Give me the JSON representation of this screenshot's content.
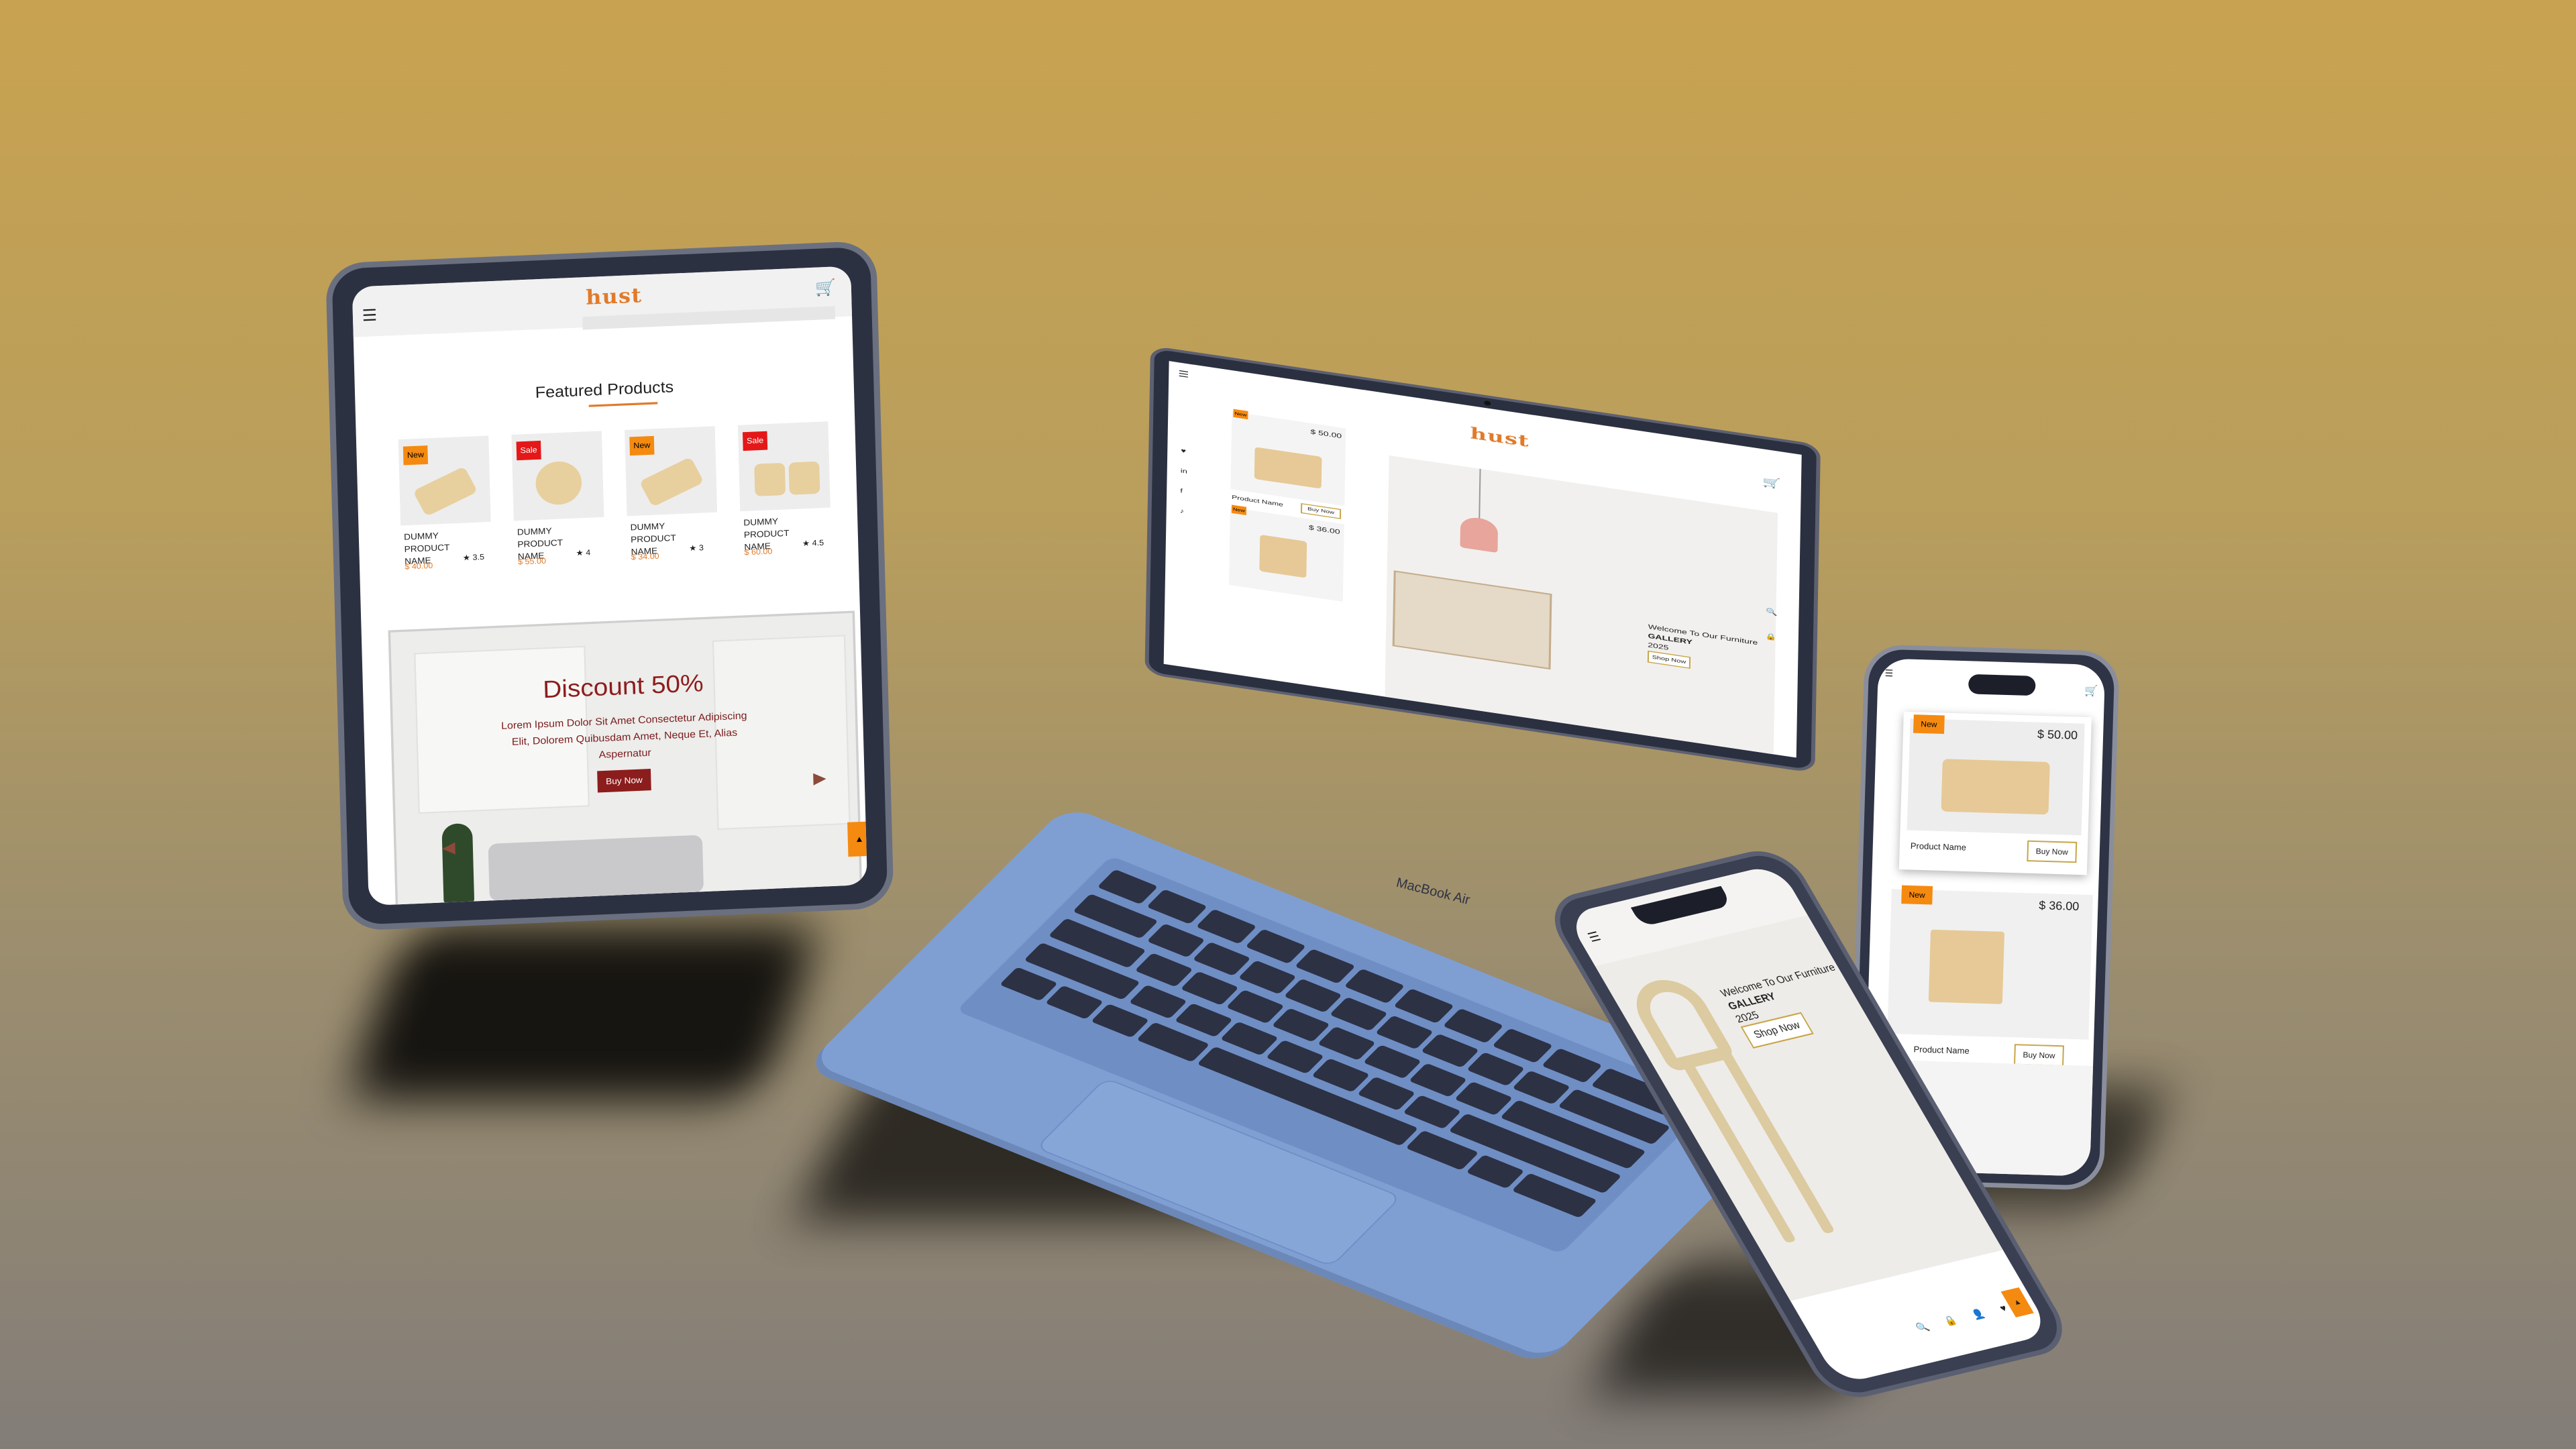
{
  "brand": {
    "logo": "hust",
    "accent": "#e07b2b",
    "new_badge": "#f58a10",
    "sale_badge": "#e41818"
  },
  "tablet": {
    "menu_icon": "☰",
    "cart_icon": "🛒",
    "featured_title": "Featured Products",
    "products": [
      {
        "badge": "New",
        "name": "DUMMY PRODUCT NAME",
        "price": "$ 40.00",
        "rating": "3.5"
      },
      {
        "badge": "Sale",
        "name": "DUMMY PRODUCT NAME",
        "price": "$ 55.00",
        "rating": "4"
      },
      {
        "badge": "New",
        "name": "DUMMY PRODUCT NAME",
        "price": "$ 34.00",
        "rating": "3"
      },
      {
        "badge": "Sale",
        "name": "DUMMY PRODUCT NAME",
        "price": "$ 60.00",
        "rating": "4.5"
      }
    ],
    "banner": {
      "title": "Discount 50%",
      "description": "Lorem Ipsum Dolor Sit Amet Consectetur Adipiscing Elit, Dolorem Quibusdam Amet, Neque Et, Alias Aspernatur",
      "button": "Buy Now",
      "prev": "◀",
      "next": "▶"
    },
    "scroll_up": "▲"
  },
  "laptop": {
    "model_label": "MacBook Air",
    "menu_icon": "☰",
    "cart_icon": "🛒",
    "social": [
      "♥",
      "in",
      "f",
      "♪"
    ],
    "cards": [
      {
        "badge": "New",
        "price": "$ 50.00",
        "name": "Product Name",
        "button": "Buy Now"
      },
      {
        "badge": "New",
        "price": "$ 36.00"
      }
    ],
    "hero": {
      "welcome": "Welcome To Our Furniture",
      "gallery": "GALLERY",
      "year": "2025",
      "button": "Shop Now"
    },
    "side_icons": [
      "🔍",
      "🔒"
    ]
  },
  "phone_tilted": {
    "menu_icon": "☰",
    "hero": {
      "welcome": "Welcome To Our Furniture",
      "gallery": "GALLERY",
      "year": "2025",
      "button": "Shop Now"
    },
    "bottom_icons": [
      "🔍",
      "🔒",
      "👤",
      "♥"
    ],
    "scroll_up": "▲"
  },
  "phone_right": {
    "menu_icon": "☰",
    "cart_icon": "🛒",
    "cards": [
      {
        "badge": "New",
        "price": "$ 50.00",
        "name": "Product Name",
        "button": "Buy Now"
      },
      {
        "badge": "New",
        "price": "$ 36.00",
        "name": "Product Name",
        "button": "Buy Now"
      }
    ]
  }
}
